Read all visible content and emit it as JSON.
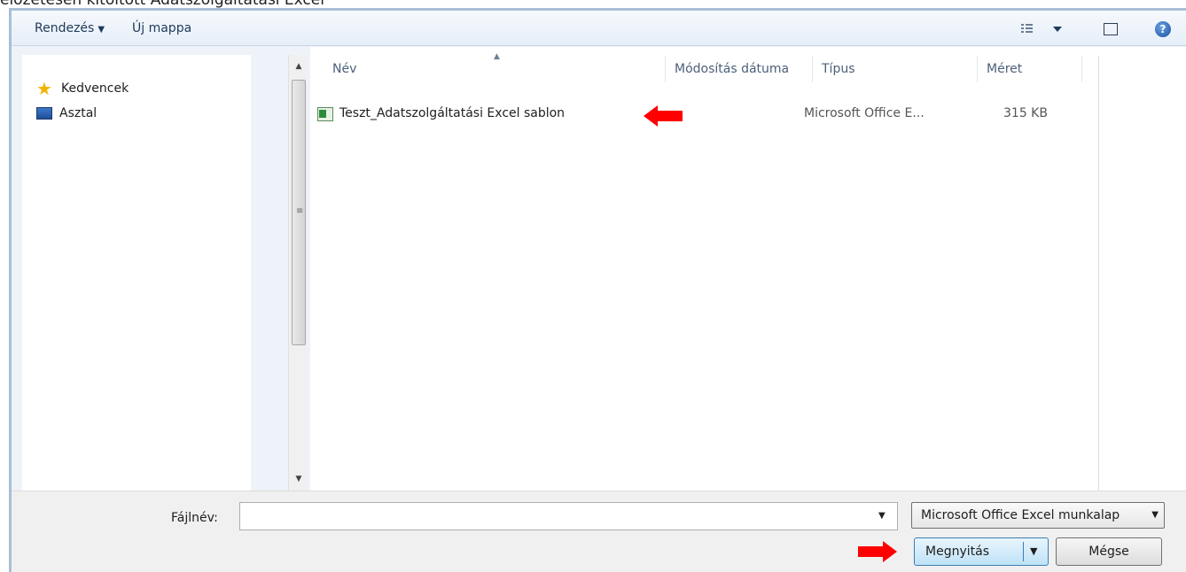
{
  "caption": "előzetesen kitöltött Adatszolgáltatási Excel",
  "toolbar": {
    "organize_label": "Rendezés",
    "new_folder_label": "Új mappa",
    "help_glyph": "?"
  },
  "nav": {
    "items": [
      {
        "label": "Kedvencek",
        "icon": "star-icon"
      },
      {
        "label": "Asztal",
        "icon": "desktop-icon"
      }
    ]
  },
  "columns": {
    "name": "Név",
    "modified": "Módosítás dátuma",
    "type": "Típus",
    "size": "Méret"
  },
  "files": [
    {
      "name": "Teszt_Adatszolgáltatási Excel sablon",
      "modified": "",
      "type": "Microsoft Office E...",
      "size": "315 KB",
      "icon": "excel-file-icon"
    }
  ],
  "footer": {
    "filename_label": "Fájlnév:",
    "filename_value": "",
    "filetype_selected": "Microsoft Office Excel munkalap",
    "open_label": "Megnyitás",
    "cancel_label": "Mégse"
  },
  "colors": {
    "accent_border": "#3c7fb1",
    "annotation_arrow": "#ff0000",
    "window_frame": "#a9bfd6"
  }
}
